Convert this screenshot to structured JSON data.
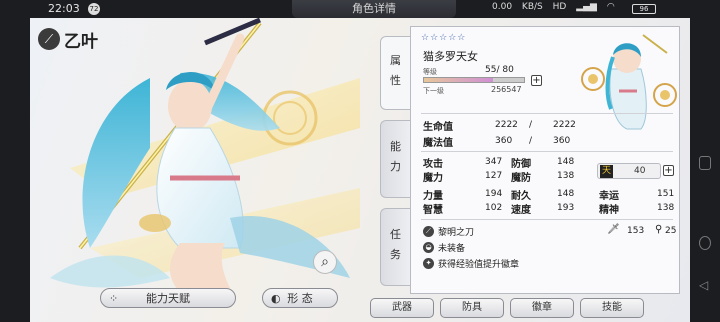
{
  "status": {
    "time": "22:03",
    "notif_count": "72",
    "screen_title": "角色详情",
    "net_speed": "0.00",
    "net_unit": "KB/S",
    "hd": "HD",
    "battery": "96"
  },
  "character": {
    "name": "乙叶",
    "title": "猫多罗天女",
    "stars": "☆☆☆☆☆"
  },
  "level": {
    "label": "等级",
    "current": "55",
    "max": "80",
    "value_text": "55/ 80",
    "progress": 0.69,
    "next_label": "下一级",
    "next_value": "256547"
  },
  "vitals": [
    {
      "label": "生命值",
      "current": "2222",
      "sep": "/",
      "max": "2222"
    },
    {
      "label": "魔法值",
      "current": "360",
      "sep": "/",
      "max": "360"
    }
  ],
  "stats": [
    {
      "label": "攻击",
      "value": "347"
    },
    {
      "label": "防御",
      "value": "148"
    },
    {
      "label": "魔力",
      "value": "127"
    },
    {
      "label": "魔防",
      "value": "138"
    },
    {
      "label": "力量",
      "value": "194"
    },
    {
      "label": "耐久",
      "value": "148"
    },
    {
      "label": "幸运",
      "value": "151"
    },
    {
      "label": "智慧",
      "value": "102"
    },
    {
      "label": "速度",
      "value": "193"
    },
    {
      "label": "精神",
      "value": "138"
    }
  ],
  "badge": {
    "glyph": "天",
    "value": "40"
  },
  "equipment": [
    {
      "name": "黎明之刀",
      "attack": "153",
      "durability": "25"
    },
    {
      "name": "未装备"
    },
    {
      "name": "获得经验值提升徽章"
    }
  ],
  "tabs": {
    "attr": [
      "属",
      "性"
    ],
    "ability": [
      "能",
      "力"
    ],
    "task": [
      "任",
      "务"
    ]
  },
  "buttons": {
    "talent": "能力天赋",
    "form": "形 态",
    "weapon": "武器",
    "armor": "防具",
    "badge": "徽章",
    "skill": "技能"
  },
  "colors": {
    "accent": "#3b5fa8",
    "level_bar_start": "#e8c79b",
    "level_bar_end": "#cf8fd4"
  }
}
